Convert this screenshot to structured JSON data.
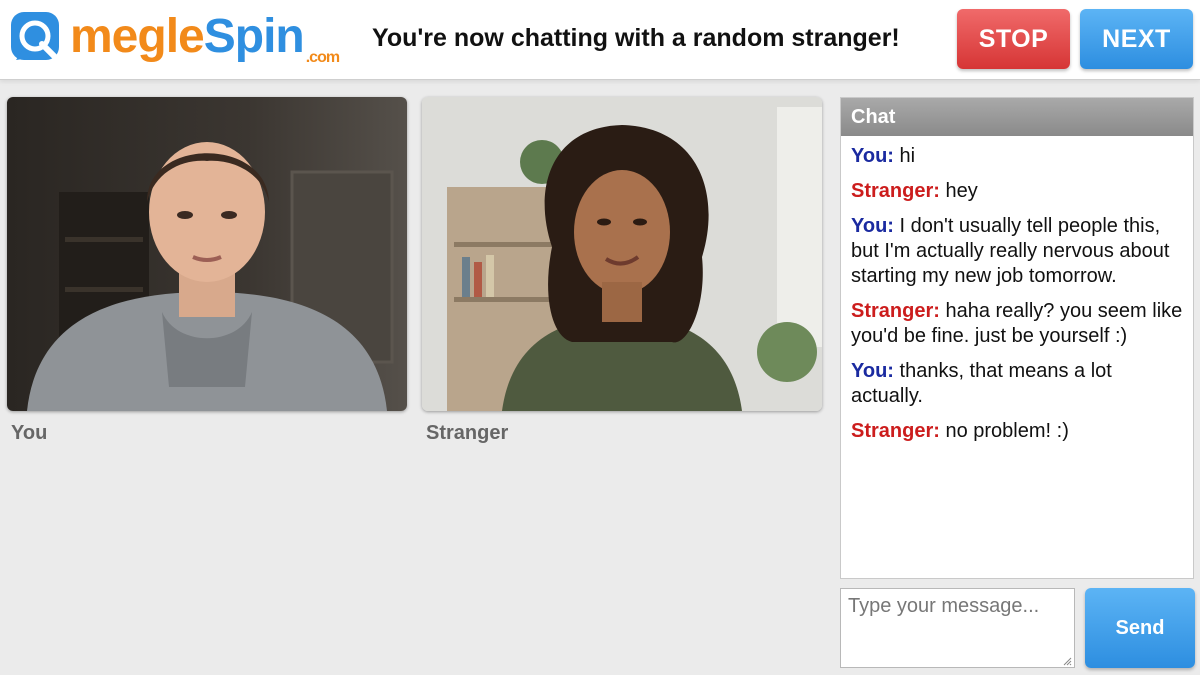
{
  "header": {
    "logo": {
      "part1": "megle",
      "part2": "Spin",
      "suffix": ".com"
    },
    "status": "You're now chatting with a random stranger!",
    "stop_label": "STOP",
    "next_label": "NEXT"
  },
  "videos": {
    "you_label": "You",
    "stranger_label": "Stranger"
  },
  "chat": {
    "title": "Chat",
    "messages": [
      {
        "sender": "You:",
        "text": "hi"
      },
      {
        "sender": "Stranger:",
        "text": "hey"
      },
      {
        "sender": "You:",
        "text": "I don't usually tell people this, but I'm actually really nervous about starting my new job tomorrow."
      },
      {
        "sender": "Stranger:",
        "text": "haha really? you seem like you'd be fine. just be yourself :)"
      },
      {
        "sender": "You:",
        "text": "thanks, that means a lot actually."
      },
      {
        "sender": "Stranger:",
        "text": "no problem! :)"
      }
    ],
    "input_placeholder": "Type your message...",
    "send_label": "Send"
  },
  "colors": {
    "brand_orange": "#f28a1a",
    "brand_blue": "#2f8fe0",
    "stop_red": "#d63535",
    "you_color": "#1a2aa0",
    "stranger_color": "#cc1d1d"
  }
}
